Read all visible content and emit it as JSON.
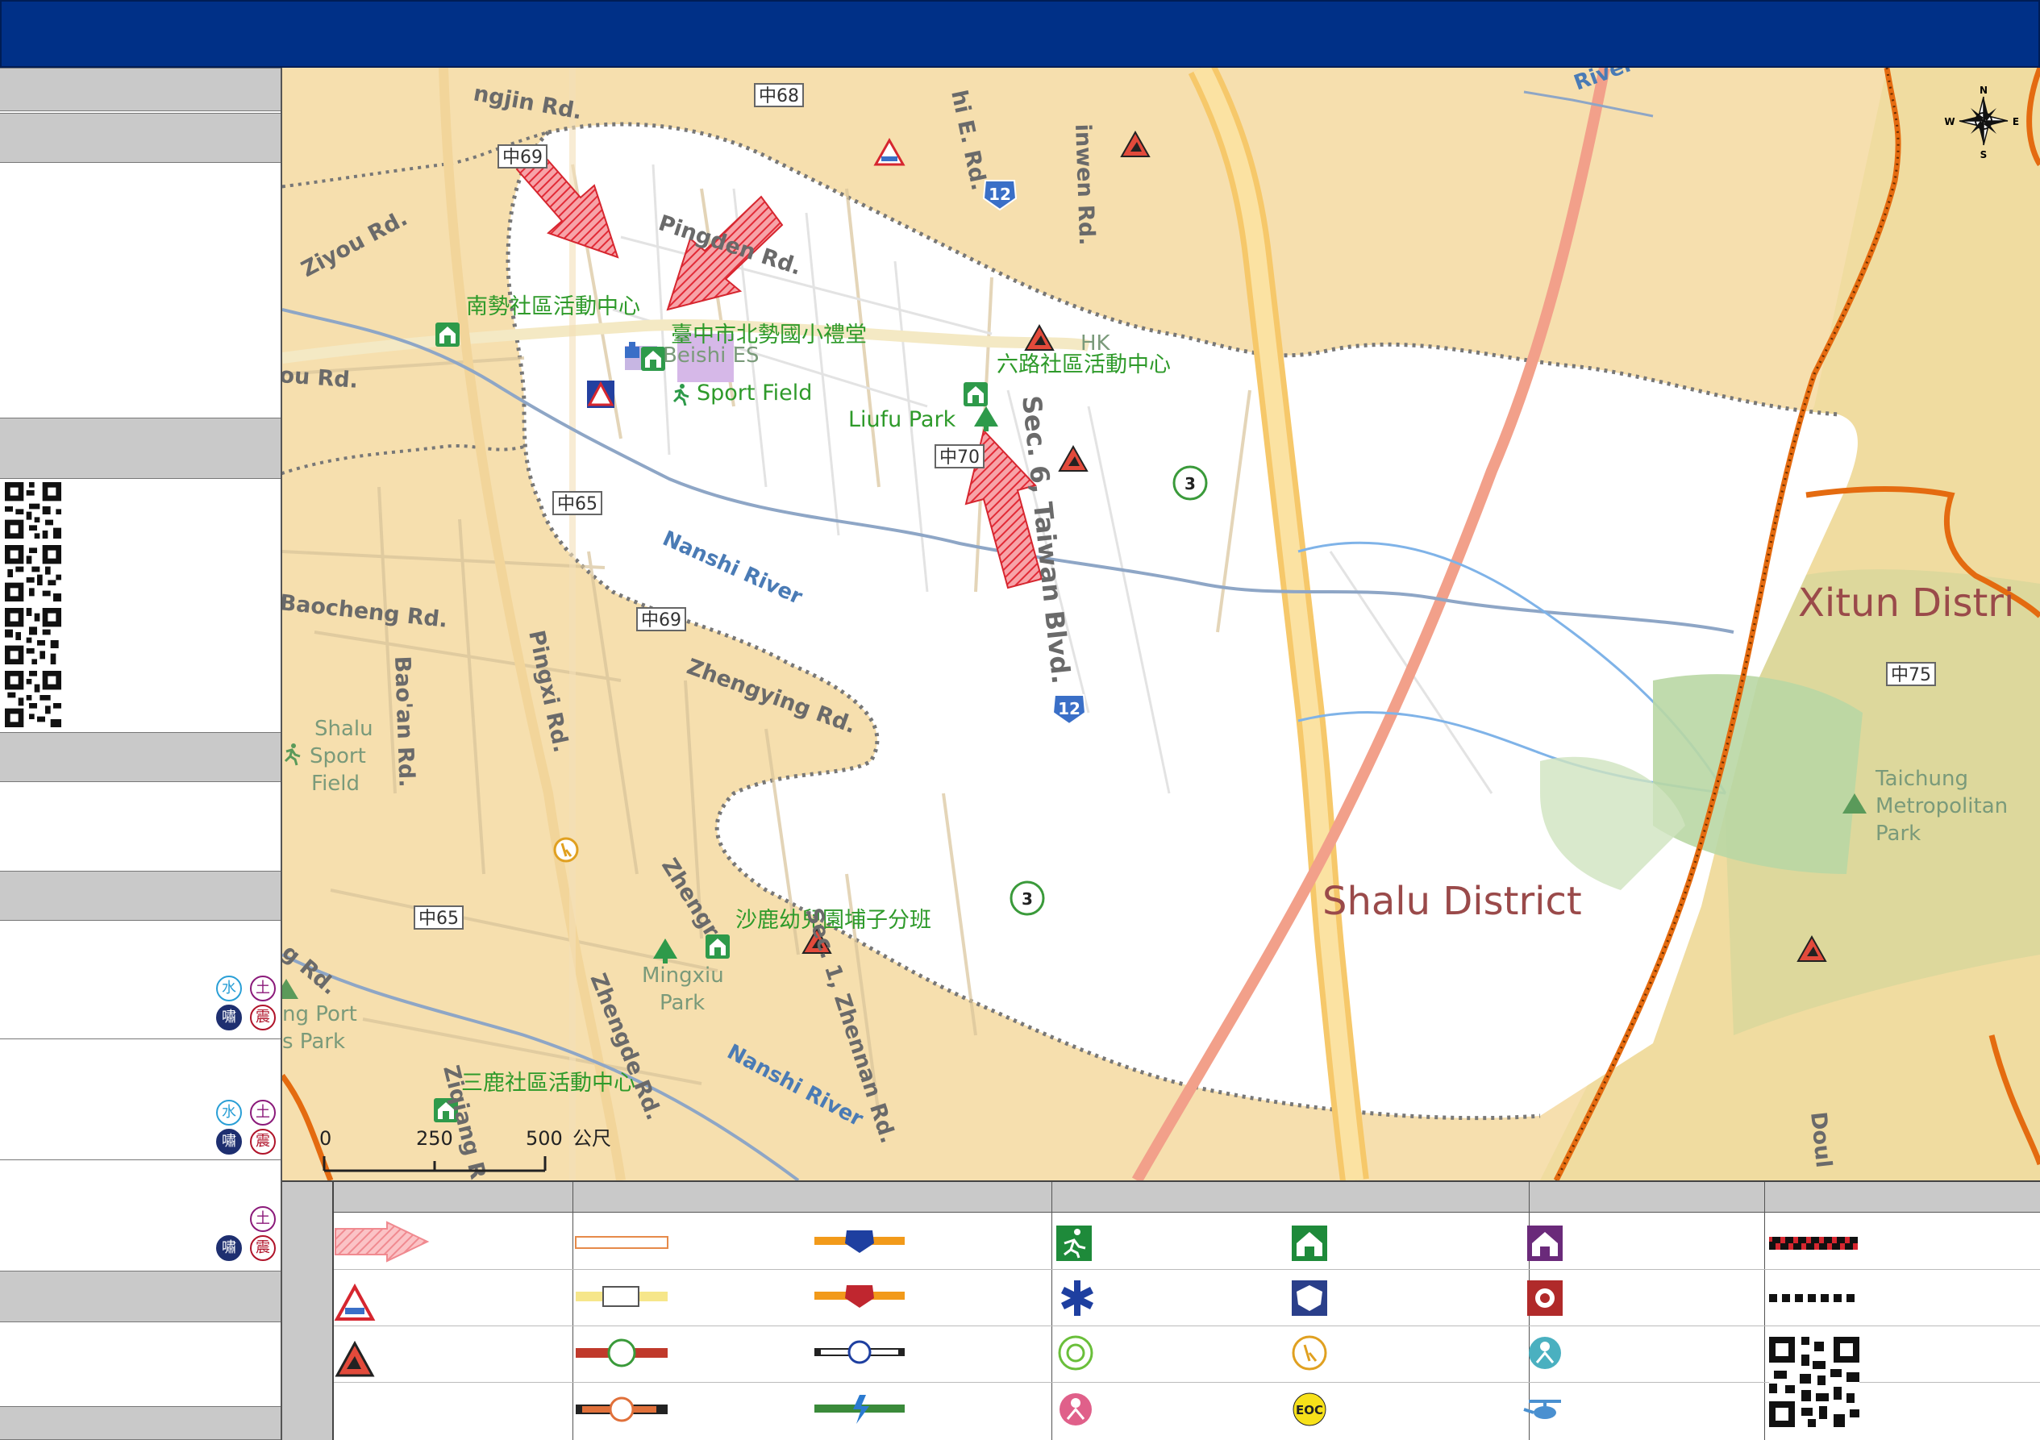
{
  "labels": {
    "nanshi_center": "南勢社區活動中心",
    "beishi_hall": "臺中市北勢國小禮堂",
    "beishi_es": "Beishi ES",
    "liulu_center": "六路社區活動中心",
    "sport_field": "Sport Field",
    "liufu_park": "Liufu Park",
    "kindergarten": "沙鹿幼兒園埔子分班",
    "sanlu_center": "三鹿社區活動中心",
    "shalu_sport_field": "Shalu Sport Field",
    "mingxiu_park": "Mingxiu Park",
    "port_park": "ng Port\ns Park",
    "taichung_park": "Taichung Metropolitan Park",
    "hk": "HK"
  },
  "districts": {
    "shalu": "Shalu District",
    "xitun": "Xitun Distri"
  },
  "roads": {
    "ziyou": "Ziyou Rd.",
    "pingden": "Pingden Rd.",
    "jou": "ou Rd.",
    "baocheng": "Baocheng Rd.",
    "baoan": "Bao'an Rd.",
    "pingxi": "Pingxi Rd.",
    "zhengying": "Zhengying Rd.",
    "zhengde": "Zhengde Rd.",
    "zhengr": "Zhengr",
    "ziqiang": "Ziqiang R",
    "zhennan": "Sec. 1, Zhennan Rd.",
    "taiwan_blvd": "Sec. 6, Taiwan Blvd.",
    "nansih_river_1": "Nanshi River",
    "nansih_river_2": "Nanshi River",
    "ngjin": "ngjin Rd.",
    "hie": "hi E. Rd.",
    "inwen": "inwen Rd.",
    "river_top": "River",
    "doul": "Doul",
    "gan": "g Rd.",
    "sec1": "Sec. 1"
  },
  "shields": {
    "z68": "中68",
    "z69a": "中69",
    "z69b": "中69",
    "z65a": "中65",
    "z65b": "中65",
    "z70": "中70",
    "z75": "中75",
    "n12a": "12",
    "n12b": "12",
    "p3a": "3",
    "p3b": "3"
  },
  "compass": {
    "n": "N",
    "s": "S",
    "e": "E",
    "w": "W"
  },
  "scale": {
    "v0": "0",
    "v1": "250",
    "v2": "500",
    "unit": "公尺"
  },
  "hazard_badges": {
    "water": "水",
    "soil": "土",
    "tsunami": "嘯",
    "quake": "震"
  },
  "legend": {
    "eoc": "EOC"
  },
  "colors": {
    "title_bar": "#003087",
    "panel_header": "#c9c9c9",
    "map_background": "#f6dfae",
    "flood_zone": "#ffffff",
    "district_boundary": "#e46b10",
    "evac_arrow": "#e8414a",
    "label_green": "#2e9a2a"
  }
}
